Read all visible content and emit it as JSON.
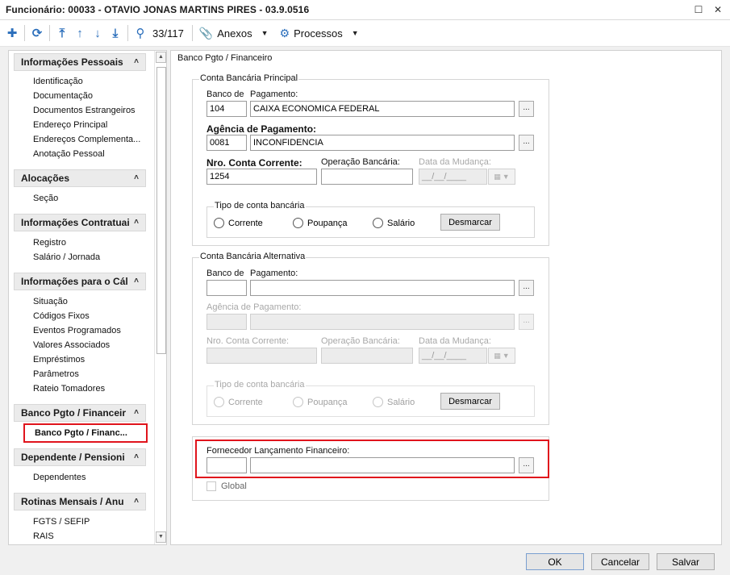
{
  "window": {
    "title": "Funcionário: 00033 - OTAVIO JONAS MARTINS PIRES - 03.9.0516",
    "maximize_icon": "maximize-icon",
    "close_icon": "close-icon"
  },
  "toolbar": {
    "counter": "33/117",
    "anexos_label": "Anexos",
    "processos_label": "Processos"
  },
  "sidebar": {
    "sections": [
      {
        "title": "Informações Pessoais",
        "items": [
          "Identificação",
          "Documentação",
          "Documentos Estrangeiros",
          "Endereço Principal",
          "Endereços Complementa...",
          "Anotação Pessoal"
        ]
      },
      {
        "title": "Alocações",
        "items": [
          "Seção"
        ]
      },
      {
        "title": "Informações Contratuai",
        "items": [
          "Registro",
          "Salário / Jornada"
        ]
      },
      {
        "title": "Informações para o Cál",
        "items": [
          "Situação",
          "Códigos Fixos",
          "Eventos Programados",
          "Valores Associados",
          "Empréstimos",
          "Parâmetros",
          "Rateio Tomadores"
        ]
      },
      {
        "title": "Banco Pgto / Financeir",
        "items": [
          "Banco Pgto / Financ..."
        ]
      },
      {
        "title": "Dependente / Pensioni",
        "items": [
          "Dependentes"
        ]
      },
      {
        "title": "Rotinas Mensais / Anu",
        "items": [
          "FGTS / SEFIP",
          "RAIS"
        ]
      }
    ]
  },
  "main": {
    "title": "Banco Pgto / Financeiro",
    "principal": {
      "legend": "Conta Bancária Principal",
      "banco_label_a": "Banco de",
      "banco_label_b": "Pagamento:",
      "banco_code": "104",
      "banco_name": "CAIXA ECONOMICA FEDERAL",
      "agencia_label": "Agência de Pagamento:",
      "agencia_code": "0081",
      "agencia_name": "INCONFIDENCIA",
      "conta_label": "Nro. Conta Corrente:",
      "conta_value": "1254",
      "operacao_label": "Operação Bancária:",
      "operacao_value": "",
      "data_label": "Data da Mudança:",
      "data_value": "__/__/____",
      "tipo_legend": "Tipo de conta bancária",
      "options": [
        "Corrente",
        "Poupança",
        "Salário"
      ],
      "desmarcar": "Desmarcar"
    },
    "alternativa": {
      "legend": "Conta Bancária Alternativa",
      "banco_label_a": "Banco de",
      "banco_label_b": "Pagamento:",
      "agencia_label": "Agência de Pagamento:",
      "conta_label": "Nro. Conta Corrente:",
      "operacao_label": "Operação Bancária:",
      "data_label": "Data da Mudança:",
      "data_value": "__/__/____",
      "tipo_legend": "Tipo de conta bancária",
      "options": [
        "Corrente",
        "Poupança",
        "Salário"
      ],
      "desmarcar": "Desmarcar"
    },
    "fornecedor": {
      "label": "Fornecedor Lançamento Financeiro:",
      "global_label": "Global"
    }
  },
  "footer": {
    "ok": "OK",
    "cancel": "Cancelar",
    "save": "Salvar"
  },
  "colors": {
    "highlight": "#e0141c",
    "toolbar_icon": "#2a6ebb"
  }
}
